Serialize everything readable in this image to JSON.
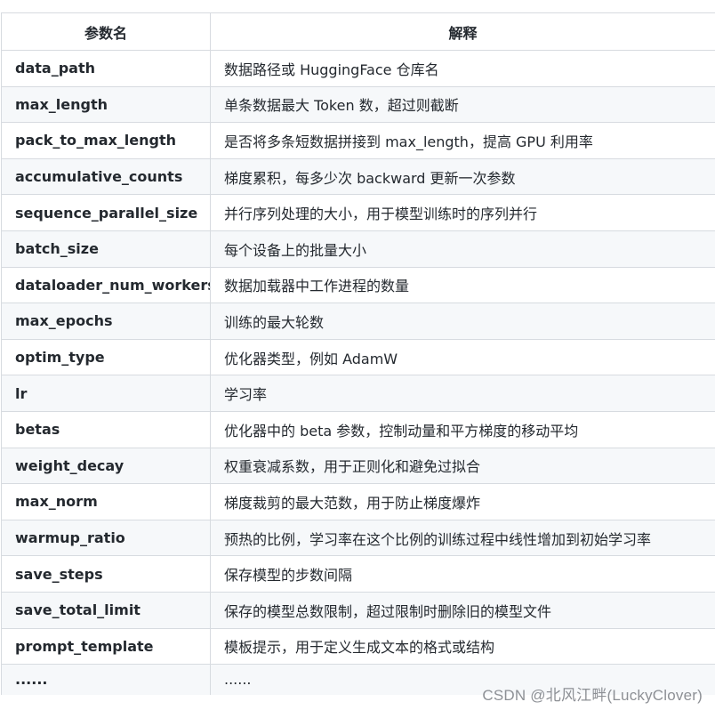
{
  "table": {
    "headers": [
      "参数名",
      "解释"
    ],
    "rows": [
      {
        "name": "data_path",
        "desc": "数据路径或 HuggingFace 仓库名"
      },
      {
        "name": "max_length",
        "desc": "单条数据最大 Token 数，超过则截断"
      },
      {
        "name": "pack_to_max_length",
        "desc": "是否将多条短数据拼接到 max_length，提高 GPU 利用率"
      },
      {
        "name": "accumulative_counts",
        "desc": "梯度累积，每多少次 backward 更新一次参数"
      },
      {
        "name": "sequence_parallel_size",
        "desc": "并行序列处理的大小，用于模型训练时的序列并行"
      },
      {
        "name": "batch_size",
        "desc": "每个设备上的批量大小"
      },
      {
        "name": "dataloader_num_workers",
        "desc": "数据加载器中工作进程的数量"
      },
      {
        "name": "max_epochs",
        "desc": "训练的最大轮数"
      },
      {
        "name": "optim_type",
        "desc": "优化器类型，例如 AdamW"
      },
      {
        "name": "lr",
        "desc": "学习率"
      },
      {
        "name": "betas",
        "desc": "优化器中的 beta 参数，控制动量和平方梯度的移动平均"
      },
      {
        "name": "weight_decay",
        "desc": "权重衰减系数，用于正则化和避免过拟合"
      },
      {
        "name": "max_norm",
        "desc": "梯度裁剪的最大范数，用于防止梯度爆炸"
      },
      {
        "name": "warmup_ratio",
        "desc": "预热的比例，学习率在这个比例的训练过程中线性增加到初始学习率"
      },
      {
        "name": "save_steps",
        "desc": "保存模型的步数间隔"
      },
      {
        "name": "save_total_limit",
        "desc": "保存的模型总数限制，超过限制时删除旧的模型文件"
      },
      {
        "name": "prompt_template",
        "desc": "模板提示，用于定义生成文本的格式或结构"
      },
      {
        "name": "......",
        "desc": "......"
      }
    ]
  },
  "watermark": "CSDN @北风江畔(LuckyClover)"
}
